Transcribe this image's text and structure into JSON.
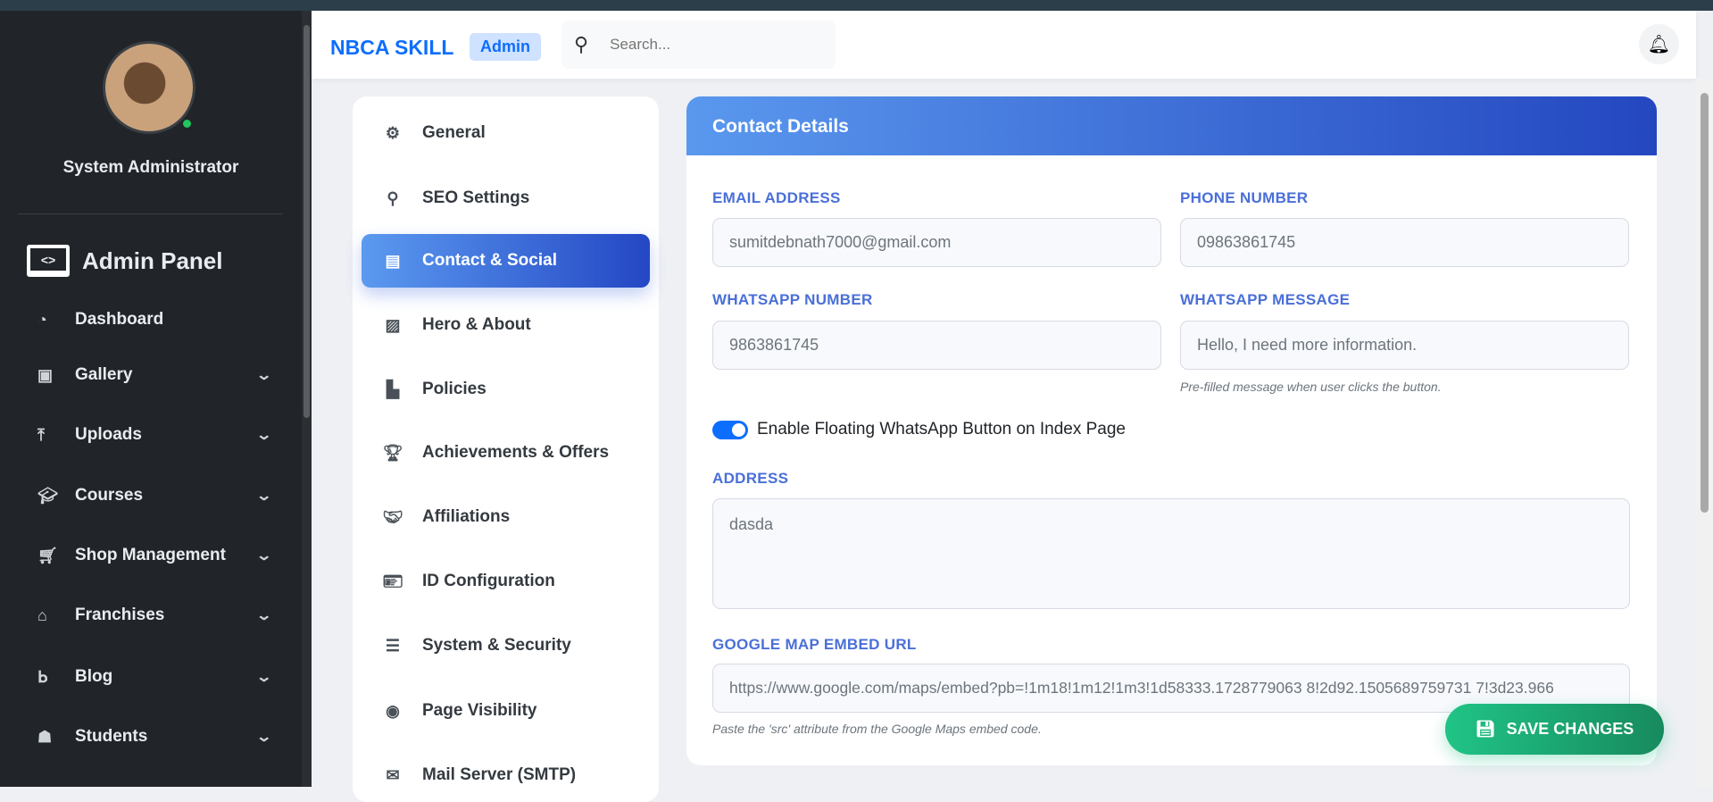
{
  "sidebar": {
    "user_name": "System Administrator",
    "brand": "Admin Panel",
    "items": [
      {
        "label": "Dashboard",
        "icon": "tachometer-icon"
      },
      {
        "label": "Gallery",
        "icon": "images-icon"
      },
      {
        "label": "Uploads",
        "icon": "upload-icon"
      },
      {
        "label": "Courses",
        "icon": "graduation-cap-icon"
      },
      {
        "label": "Shop Management",
        "icon": "cart-icon"
      },
      {
        "label": "Franchises",
        "icon": "store-icon"
      },
      {
        "label": "Blog",
        "icon": "blog-icon"
      },
      {
        "label": "Students",
        "icon": "student-icon"
      }
    ]
  },
  "header": {
    "logo": "NBCA SKILL",
    "badge": "Admin",
    "search_placeholder": "Search..."
  },
  "settings_nav": [
    {
      "label": "General"
    },
    {
      "label": "SEO Settings"
    },
    {
      "label": "Contact & Social"
    },
    {
      "label": "Hero & About"
    },
    {
      "label": "Policies"
    },
    {
      "label": "Achievements & Offers"
    },
    {
      "label": "Affiliations"
    },
    {
      "label": "ID Configuration"
    },
    {
      "label": "System & Security"
    },
    {
      "label": "Page Visibility"
    },
    {
      "label": "Mail Server (SMTP)"
    }
  ],
  "card": {
    "title": "Contact Details",
    "email_label": "EMAIL ADDRESS",
    "email": "sumitdebnath7000@gmail.com",
    "phone_label": "PHONE NUMBER",
    "phone": "09863861745",
    "whatsapp_label": "WHATSAPP NUMBER",
    "whatsapp": "9863861745",
    "wa_msg_label": "WHATSAPP MESSAGE",
    "wa_msg": "Hello, I need more information.",
    "wa_msg_help": "Pre-filled message when user clicks the button.",
    "toggle_label": "Enable Floating WhatsApp Button on Index Page",
    "toggle_on": true,
    "address_label": "ADDRESS",
    "address": "dasda",
    "map_label": "GOOGLE MAP EMBED URL",
    "map_url": "https://www.google.com/maps/embed?pb=!1m18!1m12!1m3!1d58333.1728779063 8!2d92.1505689759731 7!3d23.966",
    "map_help": "Paste the 'src' attribute from the Google Maps embed code."
  },
  "save_label": "SAVE CHANGES"
}
